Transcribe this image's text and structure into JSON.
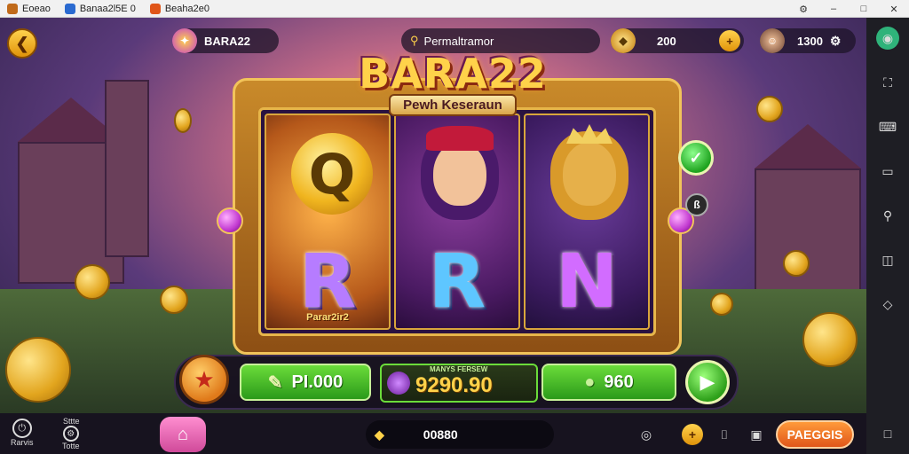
{
  "tabs": [
    {
      "label": "Eoeao",
      "icon": "game-icon",
      "color": "#c06a1a"
    },
    {
      "label": "Banaa2l5E 0",
      "icon": "app-icon",
      "color": "#2a6ad0"
    },
    {
      "label": "Beaha2e0",
      "icon": "app-icon",
      "color": "#e0561a"
    }
  ],
  "window_controls": {
    "settings": "⚙",
    "minimize": "–",
    "maximize": "□",
    "close": "✕"
  },
  "hud": {
    "back": "❮",
    "game_name": "BARA22",
    "promo_text": "Permaltramor",
    "coin_count": "200",
    "plus": "+",
    "player_balance": "1300"
  },
  "logo": {
    "title": "BARA22",
    "subtitle": "Pewh Keseraun"
  },
  "reels": {
    "reel1_letter": "R",
    "reel1_tag": "Parar2ir2",
    "reel2_letter": "R",
    "reel3_letter": "N",
    "symbol_q": "Q"
  },
  "machine": {
    "info_badge": "ß",
    "check": "✓"
  },
  "controls": {
    "bet_value": "PI.000",
    "win_label": "MANYS FERSEW",
    "win_value": "9290.90",
    "payout_value": "960",
    "spin": "▶"
  },
  "bottom": {
    "left_item1": "Rarvis",
    "left_item2_top": "Sttte",
    "left_item2_bottom": "Totte",
    "center_value": "00880",
    "orange_button": "PAEGGIS"
  },
  "colors": {
    "accent_green": "#2b9a1a",
    "accent_gold": "#ffd24a",
    "accent_orange": "#e0561a"
  }
}
